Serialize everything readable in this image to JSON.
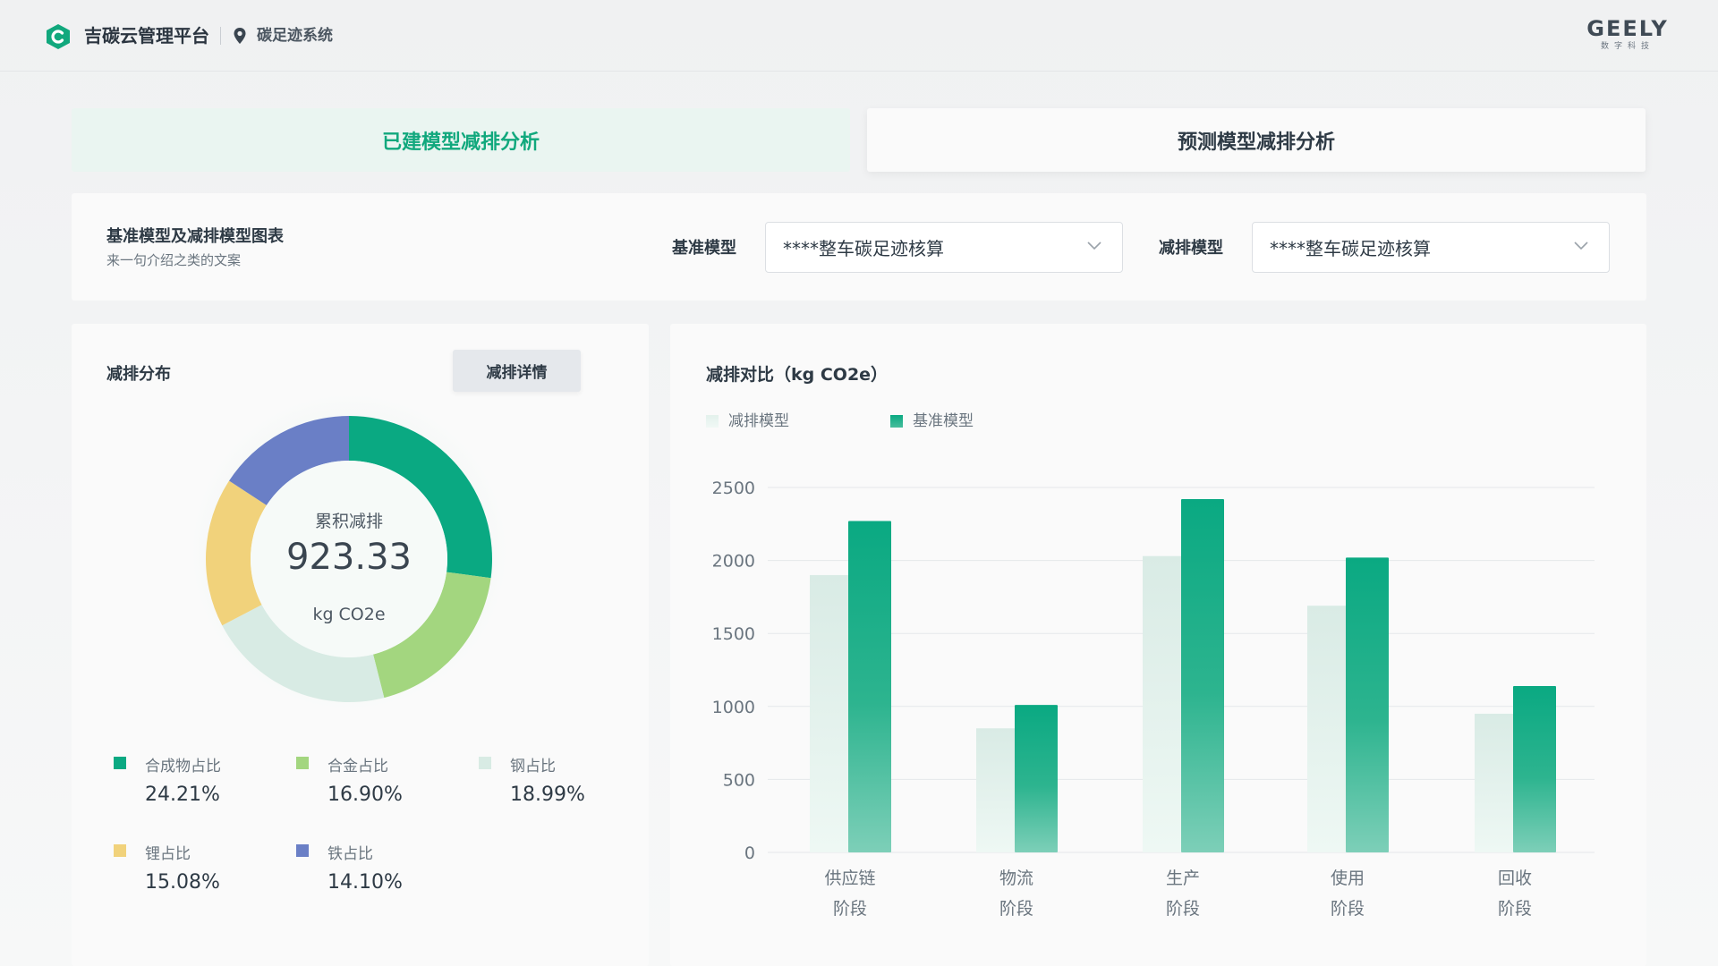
{
  "header": {
    "app_title": "吉碳云管理平台",
    "system_name": "碳足迹系统",
    "brand_name": "GEELY",
    "brand_sub": "数字科技"
  },
  "tabs": [
    {
      "label": "已建模型减排分析",
      "active": true
    },
    {
      "label": "预测模型减排分析",
      "active": false
    }
  ],
  "filter": {
    "title": "基准模型及减排模型图表",
    "description": "来一句介绍之类的文案",
    "baseline_label": "基准模型",
    "baseline_value": "****整车碳足迹核算",
    "reduction_label": "减排模型",
    "reduction_value": "****整车碳足迹核算"
  },
  "distribution": {
    "title": "减排分布",
    "detail_button": "减排详情",
    "center_label": "累积减排",
    "center_value": "923.33",
    "center_unit": "kg CO2e",
    "segments": [
      {
        "name": "合成物占比",
        "value": "24.21%",
        "color": "#0aa982"
      },
      {
        "name": "合金占比",
        "value": "16.90%",
        "color": "#a3d67f"
      },
      {
        "name": "钢占比",
        "value": "18.99%",
        "color": "#d8ebe4"
      },
      {
        "name": "锂占比",
        "value": "15.08%",
        "color": "#f1d27b"
      },
      {
        "name": "铁占比",
        "value": "14.10%",
        "color": "#6a7fc6"
      }
    ]
  },
  "colors": {
    "accent": "#11a87d",
    "baseline_bar": "#0aa982",
    "reduction_bar": "#dcece6"
  },
  "chart_data": {
    "type": "bar",
    "title": "减排对比（kg CO2e）",
    "categories": [
      [
        "供应链",
        "阶段"
      ],
      [
        "物流",
        "阶段"
      ],
      [
        "生产",
        "阶段"
      ],
      [
        "使用",
        "阶段"
      ],
      [
        "回收",
        "阶段"
      ]
    ],
    "series": [
      {
        "name": "减排模型",
        "values": [
          1900,
          850,
          2030,
          1690,
          950
        ]
      },
      {
        "name": "基准模型",
        "values": [
          2270,
          1010,
          2420,
          2020,
          1140
        ]
      }
    ],
    "yticks": [
      0,
      500,
      1000,
      1500,
      2000,
      2500
    ],
    "ylim": [
      0,
      2500
    ],
    "grid": true,
    "legend_position": "top-left"
  }
}
